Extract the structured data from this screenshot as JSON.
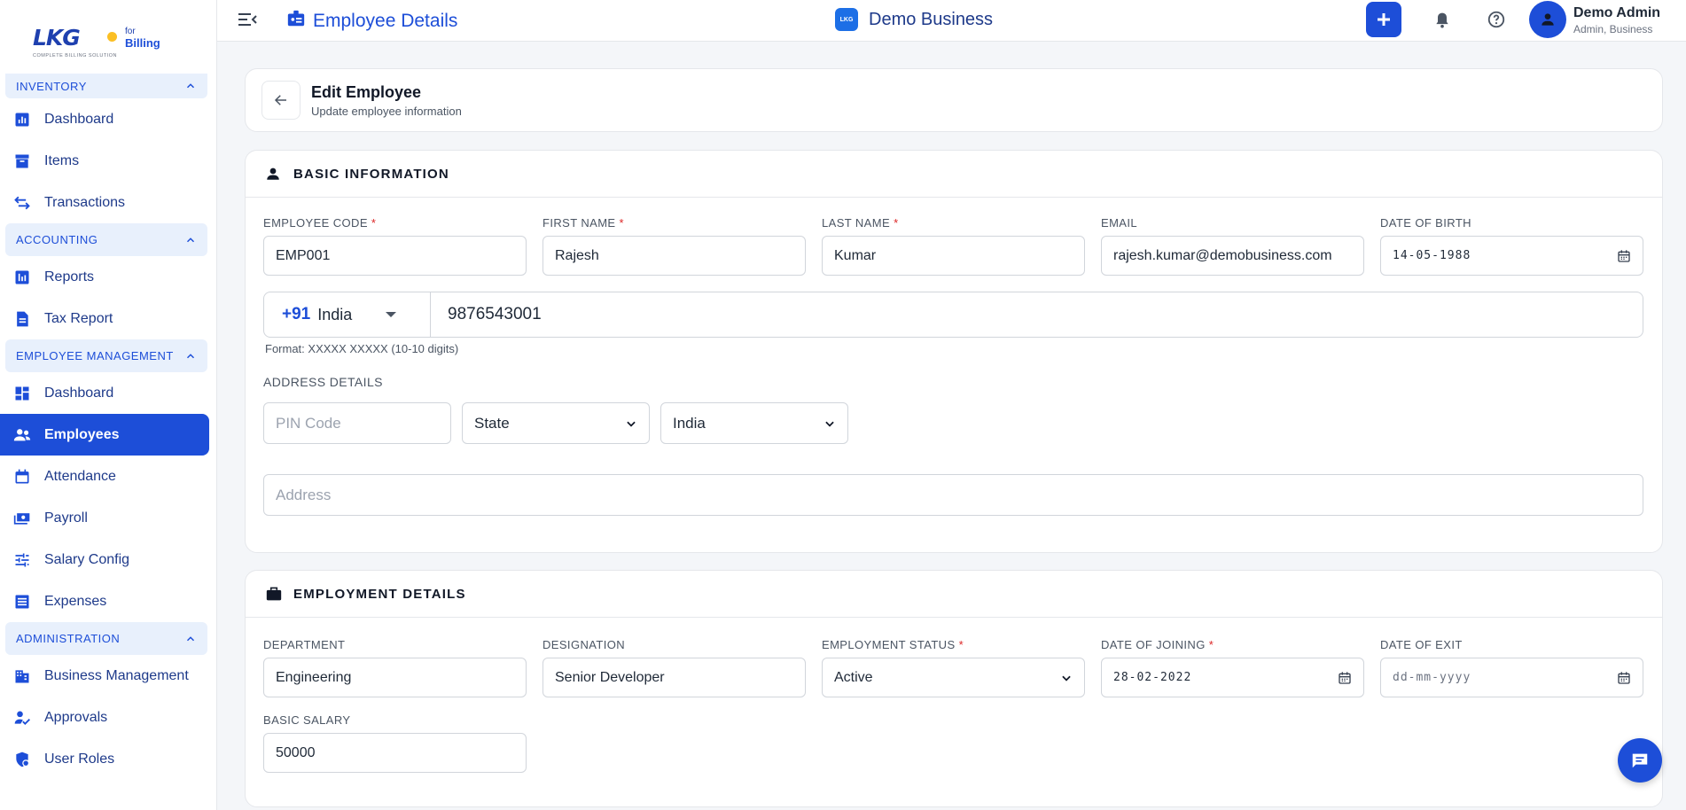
{
  "sidebar": {
    "logo": {
      "text": "LKG",
      "for": "for",
      "billing": "Billing",
      "tagline": "COMPLETE BILLING SOLUTION"
    },
    "sections": [
      {
        "title": "INVENTORY",
        "items": [
          {
            "label": "Dashboard",
            "icon": "bar-chart-icon"
          },
          {
            "label": "Items",
            "icon": "archive-icon"
          },
          {
            "label": "Transactions",
            "icon": "swap-icon"
          }
        ]
      },
      {
        "title": "ACCOUNTING",
        "items": [
          {
            "label": "Reports",
            "icon": "report-icon"
          },
          {
            "label": "Tax Report",
            "icon": "document-icon"
          }
        ]
      },
      {
        "title": "EMPLOYEE MANAGEMENT",
        "items": [
          {
            "label": "Dashboard",
            "icon": "dashboard-icon"
          },
          {
            "label": "Employees",
            "icon": "people-icon"
          },
          {
            "label": "Attendance",
            "icon": "calendar-icon"
          },
          {
            "label": "Payroll",
            "icon": "cash-icon"
          },
          {
            "label": "Salary Config",
            "icon": "tune-icon"
          },
          {
            "label": "Expenses",
            "icon": "list-icon"
          }
        ]
      },
      {
        "title": "ADMINISTRATION",
        "items": [
          {
            "label": "Business Management",
            "icon": "building-icon"
          },
          {
            "label": "Approvals",
            "icon": "approval-icon"
          },
          {
            "label": "User Roles",
            "icon": "shield-icon"
          }
        ]
      }
    ]
  },
  "topbar": {
    "title": "Employee Details",
    "business": "Demo Business",
    "business_logo": "LKG",
    "user_name": "Demo Admin",
    "user_role": "Admin, Business"
  },
  "header_card": {
    "title": "Edit Employee",
    "subtitle": "Update employee information"
  },
  "basic": {
    "title": "BASIC INFORMATION",
    "labels": {
      "code": "EMPLOYEE CODE",
      "first": "FIRST NAME",
      "last": "LAST NAME",
      "email": "EMAIL",
      "dob": "DATE OF BIRTH",
      "address_details": "ADDRESS DETAILS",
      "req": "*"
    },
    "values": {
      "code": "EMP001",
      "first": "Rajesh",
      "last": "Kumar",
      "email": "rajesh.kumar@demobusiness.com",
      "dob": "14-05-1988"
    },
    "phone": {
      "code": "+91",
      "country": "India",
      "number": "9876543001",
      "hint": "Format: XXXXX XXXXX (10-10 digits)"
    },
    "address": {
      "pin_placeholder": "PIN Code",
      "state": "State",
      "country": "India",
      "address_placeholder": "Address"
    }
  },
  "employment": {
    "title": "EMPLOYMENT DETAILS",
    "labels": {
      "department": "DEPARTMENT",
      "designation": "DESIGNATION",
      "status": "EMPLOYMENT STATUS",
      "joining": "DATE OF JOINING",
      "exit": "DATE OF EXIT",
      "salary": "BASIC SALARY",
      "req": "*"
    },
    "values": {
      "department": "Engineering",
      "designation": "Senior Developer",
      "status": "Active",
      "joining": "28-02-2022",
      "exit_placeholder": "dd-mm-yyyy",
      "salary": "50000"
    }
  },
  "colors": {
    "accent": "#1d4ed8",
    "required": "#dc2626",
    "section_bg": "#e8f0fc"
  }
}
